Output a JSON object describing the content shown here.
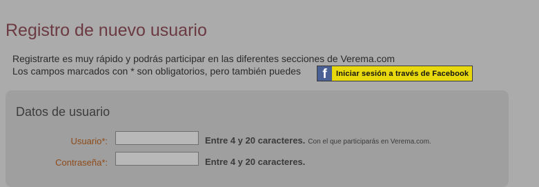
{
  "page": {
    "title": "Registro de nuevo usuario"
  },
  "intro": {
    "line1": "Registrarte es muy rápido y podrás participar en las diferentes secciones de Verema.com",
    "line2": "Los campos marcados con * son obligatorios, pero también puedes"
  },
  "facebook_button": {
    "icon_glyph": "f",
    "label": "Iniciar sesión a través de Facebook"
  },
  "section": {
    "title": "Datos de usuario"
  },
  "fields": {
    "username": {
      "label": "Usuario*:",
      "value": "",
      "hint": "Entre 4 y 20 caracteres.",
      "note": "Con el que participarás en Verema.com."
    },
    "password": {
      "label": "Contraseña*:",
      "value": "",
      "hint": "Entre 4 y 20 caracteres."
    }
  },
  "colors": {
    "page_background": "#ababab",
    "title": "#6b3a42",
    "field_label": "#8e4a17",
    "facebook_blue": "#4a5f93",
    "facebook_button_yellow": "#e8d80e"
  },
  "icons": {
    "facebook": "facebook-icon"
  }
}
